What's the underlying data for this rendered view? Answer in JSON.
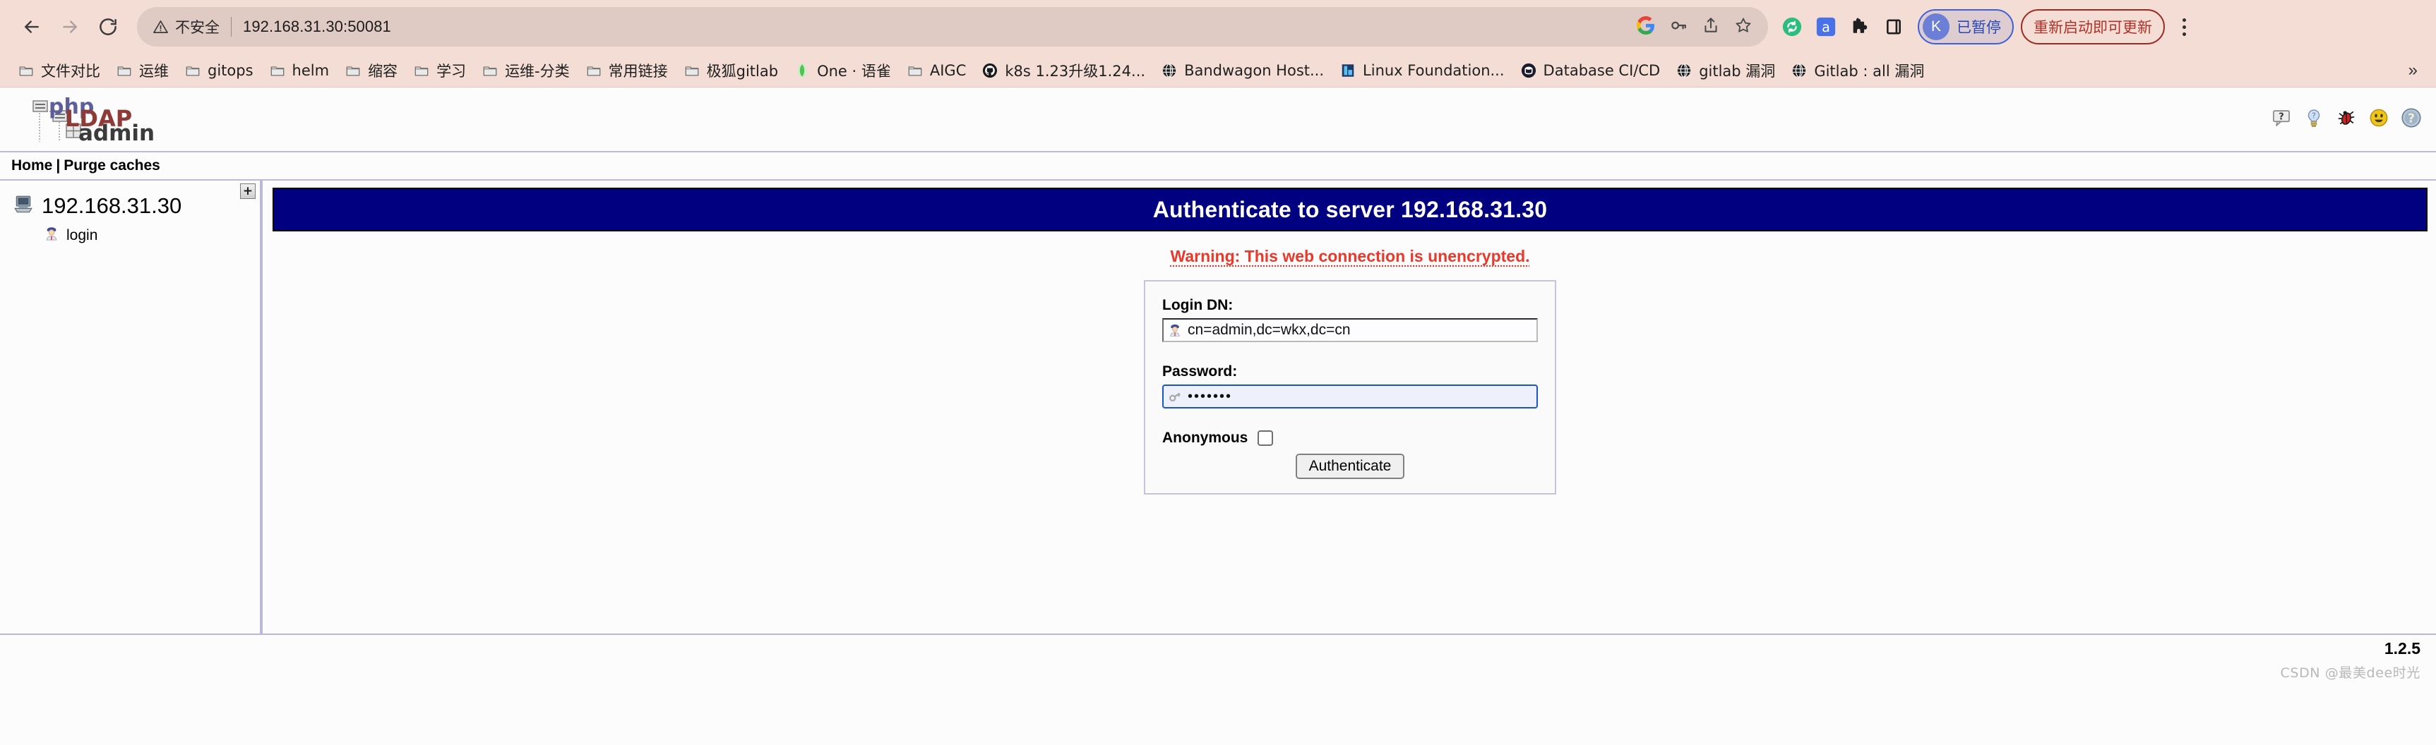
{
  "browser": {
    "nav": {
      "back_icon": "arrow-left-icon",
      "forward_icon": "arrow-right-icon",
      "reload_icon": "reload-icon"
    },
    "omnibox": {
      "security_icon": "warning-triangle-icon",
      "security_label": "不安全",
      "url": "192.168.31.30:50081",
      "trailing_icons": [
        "google-g-icon",
        "key-icon",
        "share-icon",
        "bookmark-star-icon"
      ]
    },
    "extensions": [
      {
        "name": "sync-extension-icon",
        "glyph": "↻"
      },
      {
        "name": "adblock-extension-icon",
        "glyph": "a"
      },
      {
        "name": "puzzle-extensions-icon",
        "glyph": "🧩"
      },
      {
        "name": "sidepanel-icon",
        "glyph": "▯"
      }
    ],
    "profile": {
      "avatar_letter": "K",
      "label": "已暂停"
    },
    "update_button": "重新启动即可更新",
    "menu_icon": "three-dots-menu-icon",
    "bookmarks": [
      {
        "label": "文件对比",
        "icon": "folder-icon"
      },
      {
        "label": "运维",
        "icon": "folder-icon"
      },
      {
        "label": "gitops",
        "icon": "folder-icon"
      },
      {
        "label": "helm",
        "icon": "folder-icon"
      },
      {
        "label": "缩容",
        "icon": "folder-icon"
      },
      {
        "label": "学习",
        "icon": "folder-icon"
      },
      {
        "label": "运维-分类",
        "icon": "folder-icon"
      },
      {
        "label": "常用链接",
        "icon": "folder-icon"
      },
      {
        "label": "极狐gitlab",
        "icon": "folder-icon"
      },
      {
        "label": "One · 语雀",
        "icon": "yuque-icon"
      },
      {
        "label": "AIGC",
        "icon": "folder-icon"
      },
      {
        "label": "k8s 1.23升级1.24...",
        "icon": "github-icon"
      },
      {
        "label": "Bandwagon Host...",
        "icon": "globe-icon"
      },
      {
        "label": "Linux Foundation...",
        "icon": "linux-foundation-icon"
      },
      {
        "label": "Database CI/CD",
        "icon": "bytebase-icon"
      },
      {
        "label": "gitlab 漏洞",
        "icon": "globe-icon"
      },
      {
        "label": "Gitlab : all 漏洞",
        "icon": "globe-icon"
      }
    ],
    "bookmarks_overflow": "»"
  },
  "app": {
    "logo": {
      "php": "php",
      "ldap": "LDAP",
      "admin": "admin"
    },
    "header_icons": [
      {
        "name": "speech-question-icon",
        "title": "?"
      },
      {
        "name": "lightbulb-hint-icon",
        "title": "?"
      },
      {
        "name": "bug-report-icon",
        "title": "bug"
      },
      {
        "name": "smiley-donate-icon",
        "title": "donate"
      },
      {
        "name": "help-question-icon",
        "title": "help"
      }
    ],
    "navbar": {
      "home": "Home",
      "separator": "|",
      "purge": "Purge caches"
    },
    "sidebar": {
      "collapse_glyph": "+",
      "server": {
        "label": "192.168.31.30",
        "icon": "server-computer-icon"
      },
      "child": {
        "label": "login",
        "icon": "user-login-icon"
      }
    },
    "main": {
      "banner_title": "Authenticate to server 192.168.31.30",
      "warning": "Warning: This web connection is unencrypted.",
      "form": {
        "login_dn_label": "Login DN:",
        "login_dn_value": "cn=admin,dc=wkx,dc=cn",
        "login_dn_icon": "user-icon",
        "password_label": "Password:",
        "password_value": "•••••••",
        "password_icon": "key-icon",
        "anonymous_label": "Anonymous",
        "anonymous_checked": false,
        "submit_label": "Authenticate"
      }
    },
    "footer": {
      "version": "1.2.5"
    },
    "watermark": "CSDN @最美dee时光"
  },
  "colors": {
    "chrome_bg": "#f3ddd5",
    "omnibox_bg": "#dfcbc3",
    "banner_navy": "#000080",
    "warning_red": "#e8392a",
    "panel_border": "#b9b9d8",
    "focus_blue": "#1a56c4",
    "update_red": "#b03229",
    "profile_blue": "#2a47bb"
  }
}
